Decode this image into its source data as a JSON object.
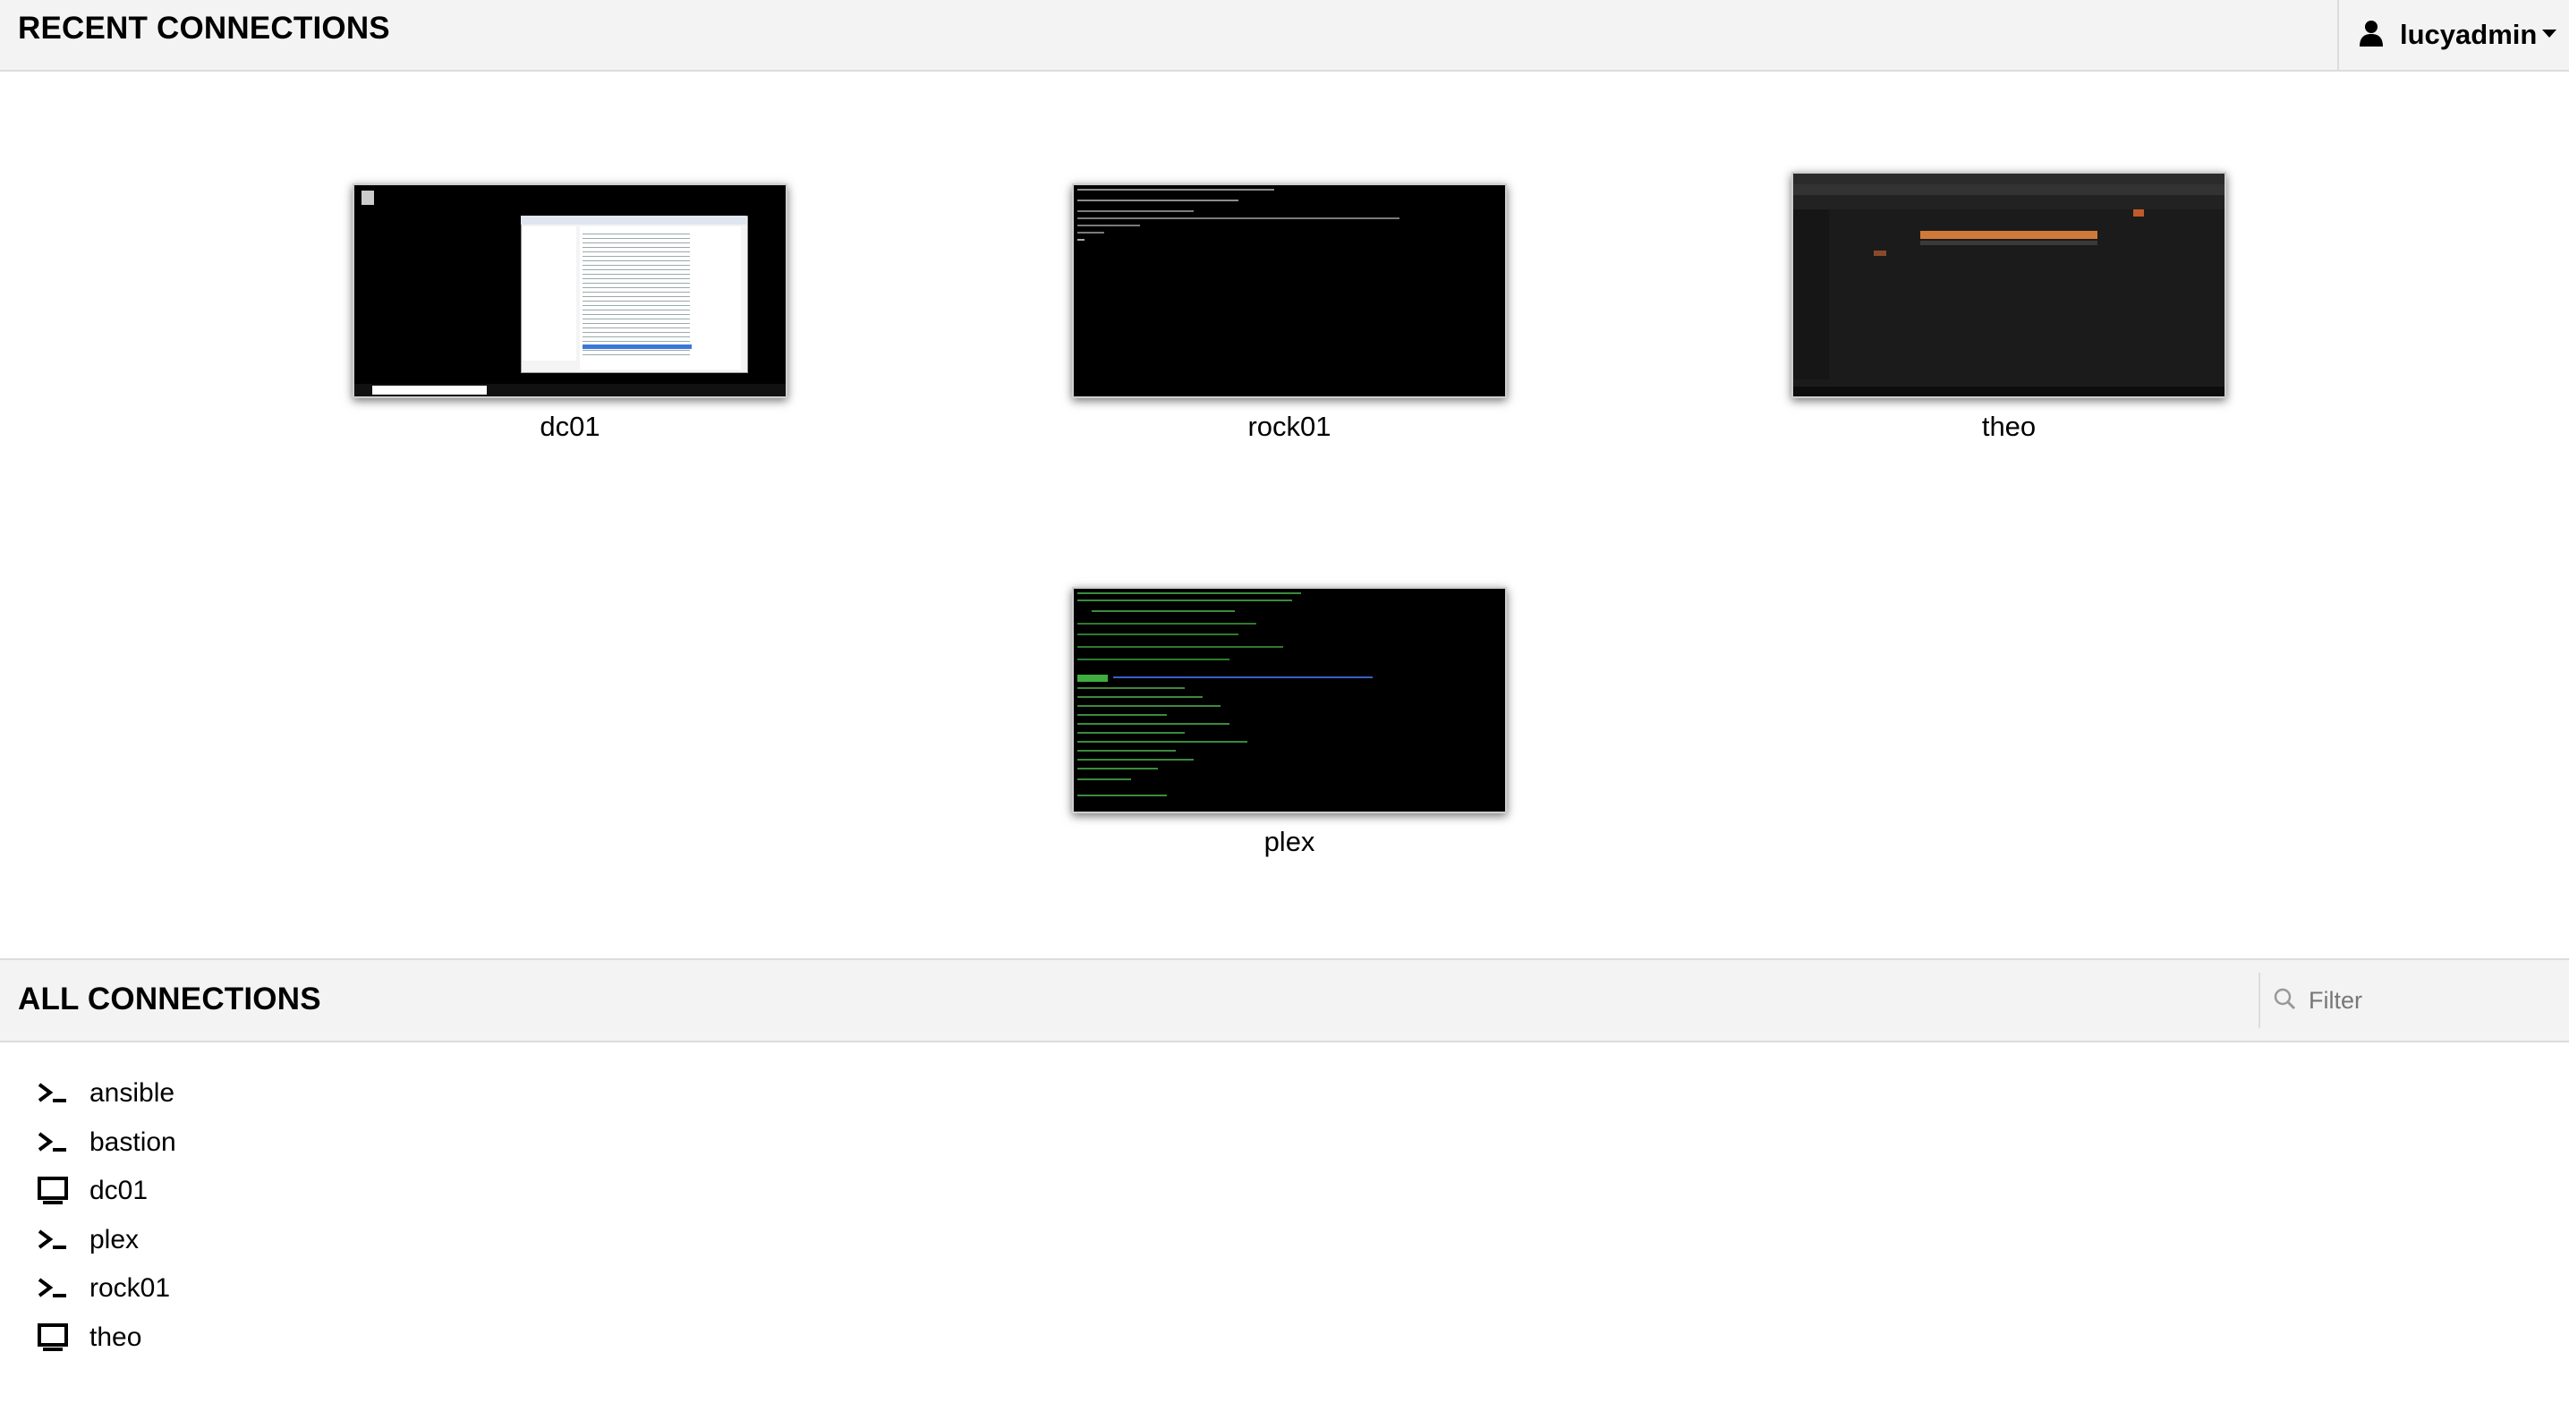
{
  "header": {
    "title": "RECENT CONNECTIONS",
    "username": "lucyadmin"
  },
  "recent": [
    {
      "name": "dc01"
    },
    {
      "name": "rock01"
    },
    {
      "name": "theo"
    },
    {
      "name": "plex"
    }
  ],
  "all": {
    "title": "ALL CONNECTIONS",
    "filter_placeholder": "Filter",
    "items": [
      {
        "label": "ansible",
        "icon": "terminal-icon"
      },
      {
        "label": "bastion",
        "icon": "terminal-icon"
      },
      {
        "label": "dc01",
        "icon": "desktop-icon"
      },
      {
        "label": "plex",
        "icon": "terminal-icon"
      },
      {
        "label": "rock01",
        "icon": "terminal-icon"
      },
      {
        "label": "theo",
        "icon": "desktop-icon"
      }
    ]
  }
}
